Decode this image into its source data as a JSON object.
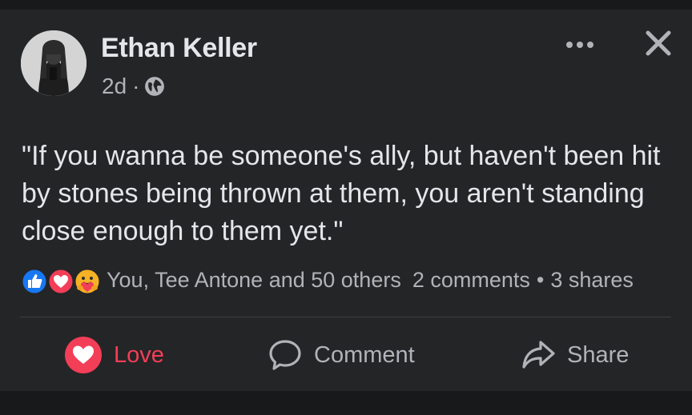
{
  "post": {
    "author": "Ethan Keller",
    "time": "2d",
    "separator": "·",
    "privacy_icon": "globe-icon",
    "text": "\"If you wanna be someone's ally, but haven't been hit by stones being thrown at them, you aren't standing close enough to them yet.\"",
    "header_icons": [
      "more-options-icon",
      "close-icon"
    ]
  },
  "reactions": {
    "icons": [
      "like-icon",
      "love-icon",
      "care-icon"
    ],
    "summary": "You, Tee Antone and 50 others",
    "comments": "2 comments",
    "bullet": "•",
    "shares": "3 shares"
  },
  "actions": {
    "love": "Love",
    "comment": "Comment",
    "share": "Share"
  },
  "colors": {
    "background": "#18191b",
    "card": "#242526",
    "text_primary": "#e4e6eb",
    "text_secondary": "#b0b3b8",
    "love_red": "#f33e58",
    "like_blue": "#1877f2"
  }
}
